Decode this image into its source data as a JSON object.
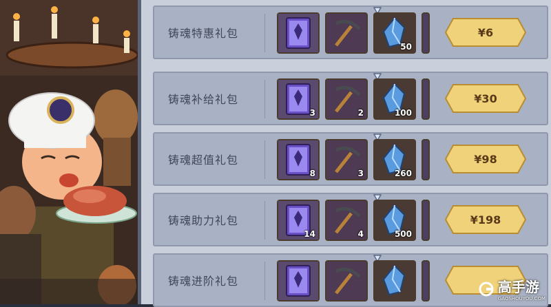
{
  "packs": [
    {
      "name": "铸魂特惠礼包",
      "price": "¥6",
      "items": [
        {
          "type": "card",
          "count": ""
        },
        {
          "type": "pickaxe",
          "count": ""
        },
        {
          "type": "crystal",
          "count": "50"
        }
      ]
    },
    {
      "name": "铸魂补给礼包",
      "price": "¥30",
      "items": [
        {
          "type": "card",
          "count": "3"
        },
        {
          "type": "pickaxe",
          "count": "2"
        },
        {
          "type": "crystal",
          "count": "100"
        }
      ]
    },
    {
      "name": "铸魂超值礼包",
      "price": "¥98",
      "items": [
        {
          "type": "card",
          "count": "8"
        },
        {
          "type": "pickaxe",
          "count": "3"
        },
        {
          "type": "crystal",
          "count": "260"
        }
      ]
    },
    {
      "name": "铸魂助力礼包",
      "price": "¥198",
      "items": [
        {
          "type": "card",
          "count": "14"
        },
        {
          "type": "pickaxe",
          "count": "4"
        },
        {
          "type": "crystal",
          "count": "500"
        }
      ]
    },
    {
      "name": "铸魂进阶礼包",
      "price": "",
      "items": [
        {
          "type": "card",
          "count": ""
        },
        {
          "type": "pickaxe",
          "count": ""
        },
        {
          "type": "crystal",
          "count": ""
        }
      ]
    }
  ],
  "watermark": {
    "title": "高手游",
    "subtitle": "GAOSHOUYOU.COM"
  },
  "colors": {
    "price_gold": "#f0d27a",
    "panel": "#c9d0dc",
    "row": "#a9b2c4"
  }
}
